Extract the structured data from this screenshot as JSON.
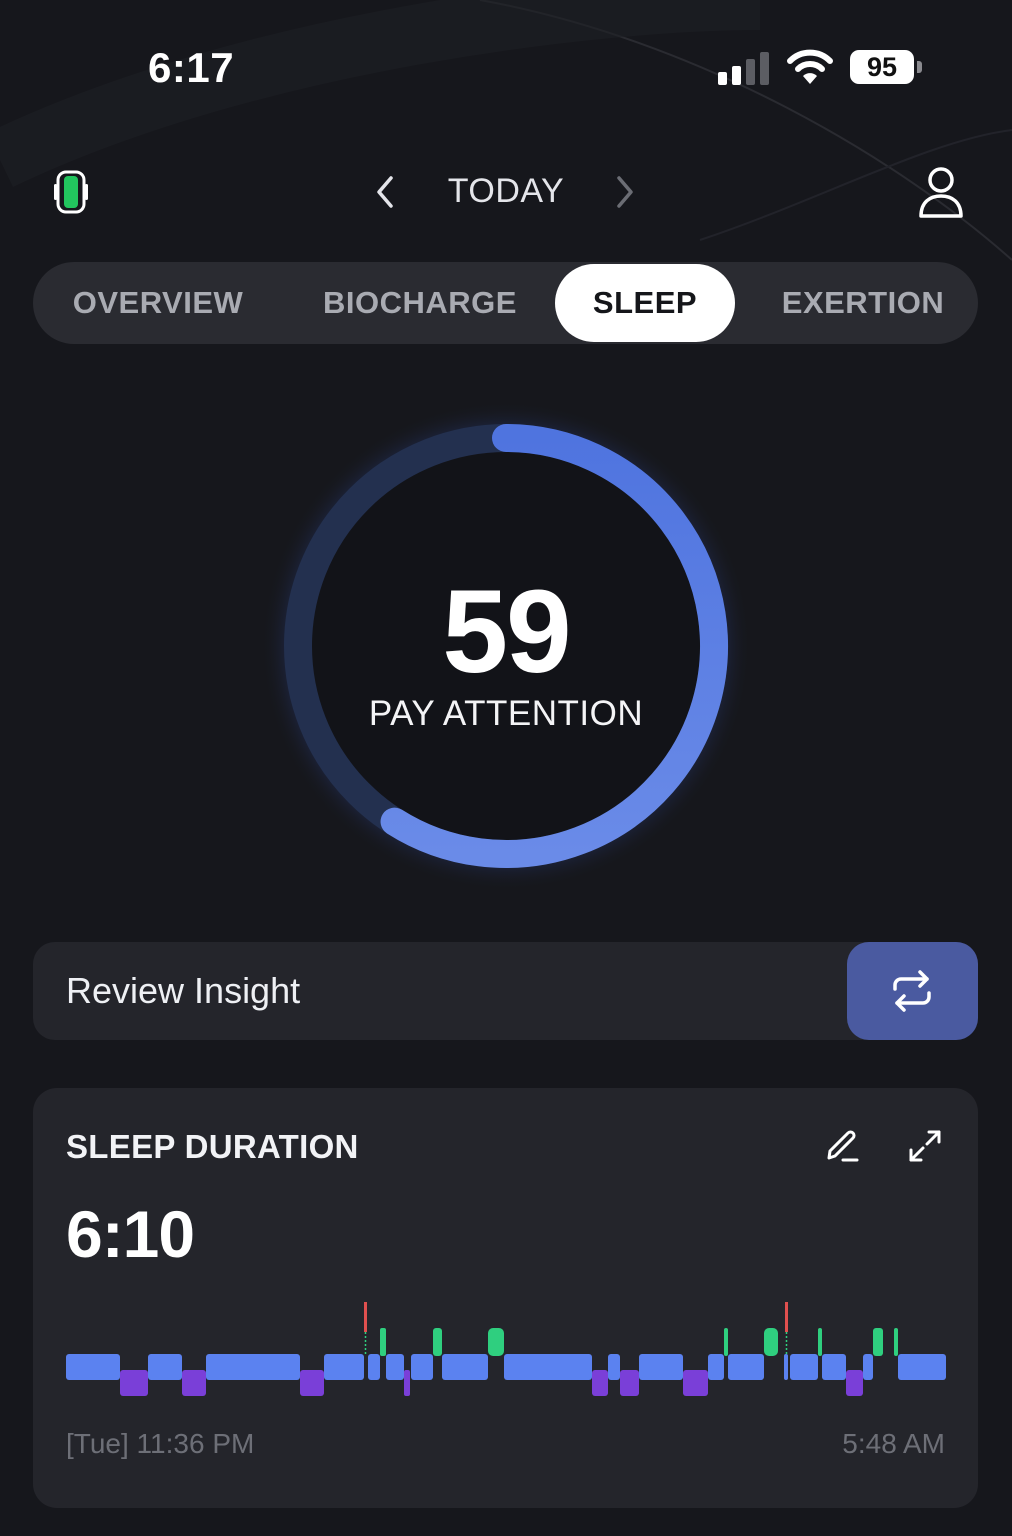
{
  "status_bar": {
    "time": "6:17",
    "battery_level": "95",
    "icons": [
      "signal-icon",
      "wifi-icon",
      "battery-icon"
    ]
  },
  "header": {
    "title": "TODAY",
    "icons": [
      "device-icon",
      "chevron-left-icon",
      "chevron-right-icon",
      "profile-icon"
    ]
  },
  "tabs": [
    {
      "label": "OVERVIEW",
      "active": false
    },
    {
      "label": "BIOCHARGE",
      "active": false
    },
    {
      "label": "SLEEP",
      "active": true
    },
    {
      "label": "EXERTION",
      "active": false
    }
  ],
  "sleep_score": {
    "value": "59",
    "label": "PAY ATTENTION",
    "ring_color": "#5b7ee3"
  },
  "insight": {
    "label": "Review Insight",
    "button_icon": "refresh-icon"
  },
  "sleep_duration": {
    "title": "SLEEP DURATION",
    "value": "6:10",
    "start_time": "[Tue] 11:36 PM",
    "end_time": "5:48 AM",
    "stage_colors": {
      "light": "#5b82f0",
      "deep": "#7a3fd8",
      "rem": "#2fcf7f",
      "awake": "#e0504f"
    },
    "icons": [
      "edit-icon",
      "expand-icon"
    ]
  }
}
